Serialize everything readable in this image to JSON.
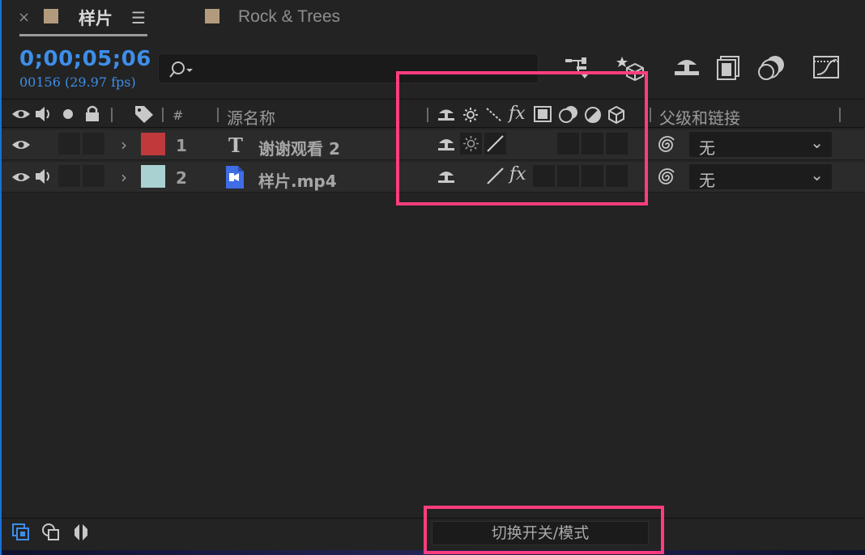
{
  "tabs": [
    {
      "label": "样片",
      "swatch_color": "#b29b7d",
      "active": true
    },
    {
      "label": "Rock & Trees",
      "swatch_color": "#b29b7d",
      "active": false
    }
  ],
  "time": {
    "timecode": "0;00;05;06",
    "frames_fps": "00156 (29.97 fps)"
  },
  "search": {
    "placeholder": ""
  },
  "columns": {
    "number": "#",
    "source_name": "源名称",
    "parent": "父级和链接"
  },
  "layers": [
    {
      "number": "1",
      "name": "谢谢观看 2",
      "type_icon": "text-layer-icon",
      "label_color": "#c0393b",
      "parent": "无"
    },
    {
      "number": "2",
      "name": "样片.mp4",
      "type_icon": "video-file-icon",
      "label_color": "#a9d1d2",
      "parent": "无"
    }
  ],
  "bottom": {
    "toggle_label": "切换开关/模式"
  },
  "colors": {
    "accent": "#3d8ee8",
    "annotation": "#ff3d7f"
  }
}
